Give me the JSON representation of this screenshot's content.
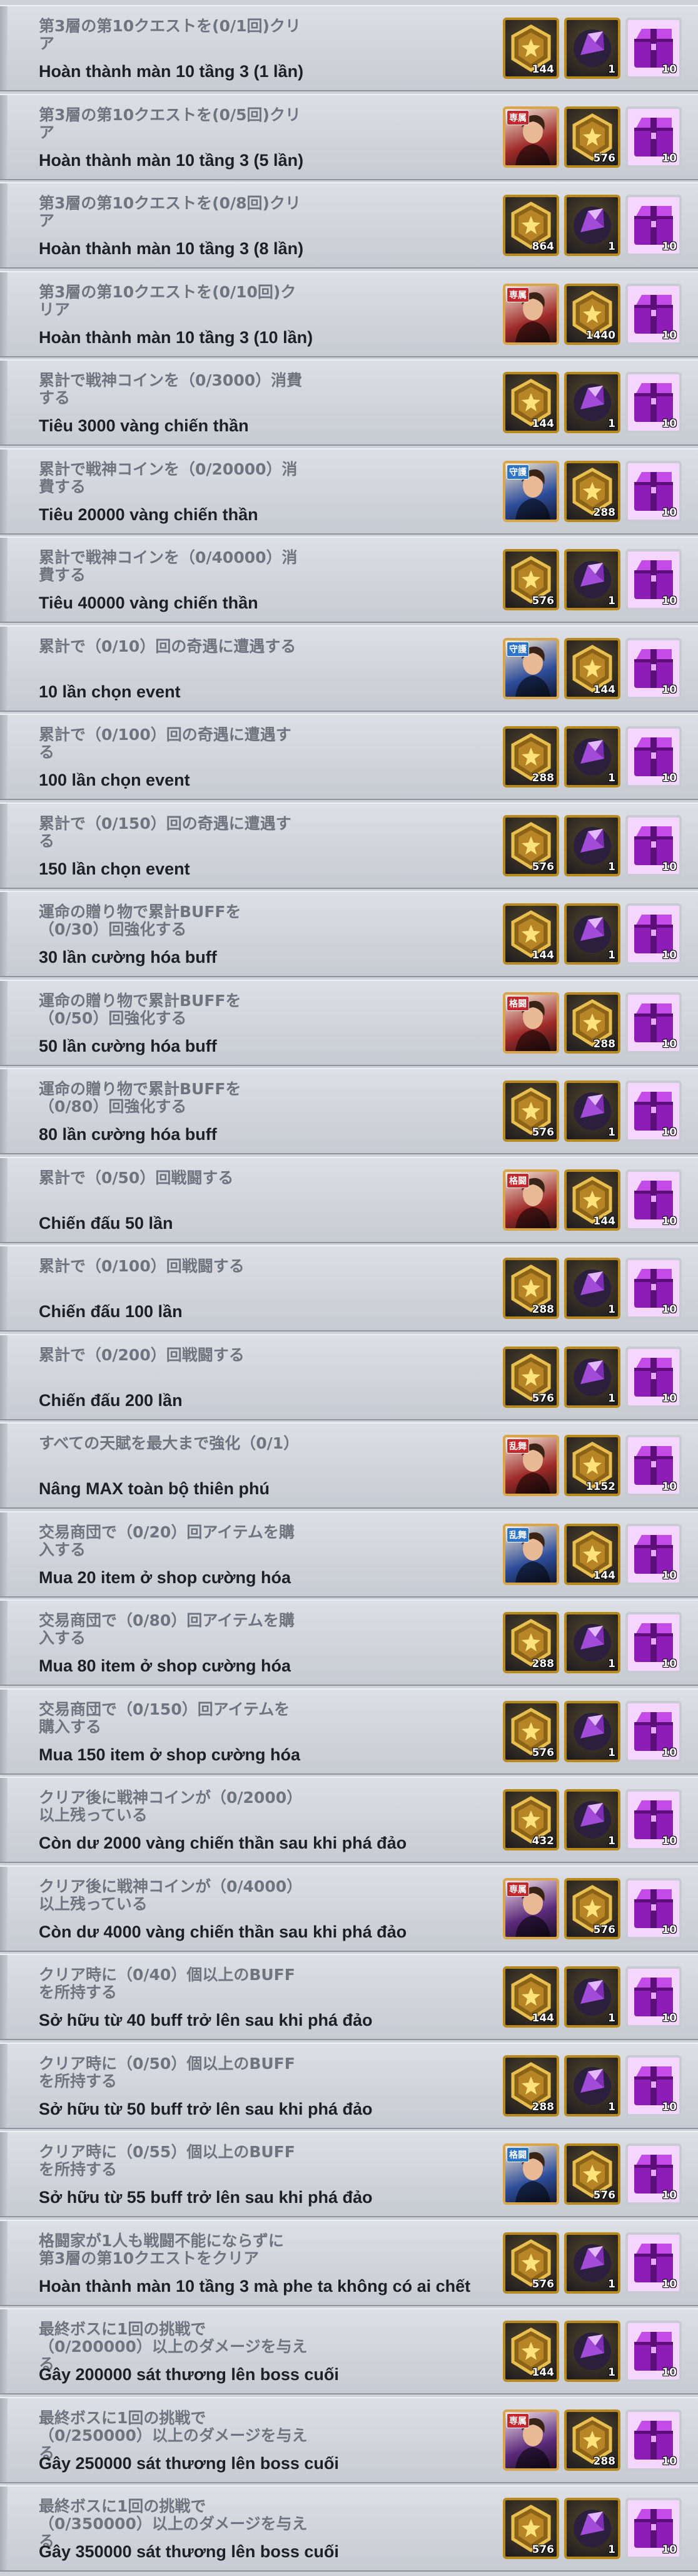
{
  "quests": [
    {
      "jp": "第3層の第10クエストを(0/1回)クリ\nア",
      "vi": "Hoàn thành màn 10 tầng 3 (1 lần)",
      "rewards": [
        {
          "type": "medal",
          "icon": "star-medal-icon",
          "qty": "144"
        },
        {
          "type": "gem",
          "icon": "purple-gem-icon",
          "qty": "1"
        },
        {
          "type": "chest",
          "icon": "purple-chest-icon",
          "qty": "10"
        }
      ]
    },
    {
      "jp": "第3層の第10クエストを(0/5回)クリ\nア",
      "vi": "Hoàn thành màn 10 tầng 3 (5 lần)",
      "rewards": [
        {
          "type": "hero",
          "icon": "fighter-portrait-icon",
          "tag": "専属",
          "tone": "red",
          "qty": ""
        },
        {
          "type": "medal",
          "icon": "star-medal-icon",
          "qty": "576"
        },
        {
          "type": "chest",
          "icon": "purple-chest-icon",
          "qty": "10"
        }
      ]
    },
    {
      "jp": "第3層の第10クエストを(0/8回)クリ\nア",
      "vi": "Hoàn thành màn 10 tầng 3 (8 lần)",
      "rewards": [
        {
          "type": "medal",
          "icon": "star-medal-icon",
          "qty": "864"
        },
        {
          "type": "gem",
          "icon": "purple-gem-icon",
          "qty": "1"
        },
        {
          "type": "chest",
          "icon": "purple-chest-icon",
          "qty": "10"
        }
      ]
    },
    {
      "jp": "第3層の第10クエストを(0/10回)ク\nリア",
      "vi": "Hoàn thành màn 10 tầng 3 (10 lần)",
      "rewards": [
        {
          "type": "hero",
          "icon": "masked-fighter-portrait-icon",
          "tag": "専属",
          "tone": "red",
          "qty": ""
        },
        {
          "type": "medal",
          "icon": "star-medal-icon",
          "qty": "1440"
        },
        {
          "type": "chest",
          "icon": "purple-chest-icon",
          "qty": "10"
        }
      ]
    },
    {
      "jp": "累計で戦神コインを（0/3000）消費\nする",
      "vi": "Tiêu 3000 vàng chiến thần",
      "rewards": [
        {
          "type": "medal",
          "icon": "star-medal-icon",
          "qty": "144"
        },
        {
          "type": "gem",
          "icon": "purple-gem-icon",
          "qty": "1"
        },
        {
          "type": "chest",
          "icon": "purple-chest-icon",
          "qty": "10"
        }
      ]
    },
    {
      "jp": "累計で戦神コインを（0/20000）消\n費する",
      "vi": "Tiêu 20000 vàng chiến thần",
      "rewards": [
        {
          "type": "hero",
          "icon": "blonde-fighter-portrait-icon",
          "tag": "守護",
          "tone": "blue",
          "qty": ""
        },
        {
          "type": "medal",
          "icon": "star-medal-icon",
          "qty": "288"
        },
        {
          "type": "chest",
          "icon": "purple-chest-icon",
          "qty": "10"
        }
      ]
    },
    {
      "jp": "累計で戦神コインを（0/40000）消\n費する",
      "vi": "Tiêu 40000 vàng chiến thần",
      "rewards": [
        {
          "type": "medal",
          "icon": "star-medal-icon",
          "qty": "576"
        },
        {
          "type": "gem",
          "icon": "purple-gem-icon",
          "qty": "1"
        },
        {
          "type": "chest",
          "icon": "purple-chest-icon",
          "qty": "10"
        }
      ]
    },
    {
      "jp": "累計で（0/10）回の奇遇に遭遇する",
      "vi": "10 lần chọn event",
      "rewards": [
        {
          "type": "hero",
          "icon": "fighter-portrait-icon",
          "tag": "守護",
          "tone": "blue",
          "qty": ""
        },
        {
          "type": "medal",
          "icon": "star-medal-icon",
          "qty": "144"
        },
        {
          "type": "chest",
          "icon": "purple-chest-icon",
          "qty": "10"
        }
      ]
    },
    {
      "jp": "累計で（0/100）回の奇遇に遭遇す\nる",
      "vi": "100 lần chọn event",
      "rewards": [
        {
          "type": "medal",
          "icon": "star-medal-icon",
          "qty": "288"
        },
        {
          "type": "gem",
          "icon": "purple-gem-icon",
          "qty": "1"
        },
        {
          "type": "chest",
          "icon": "purple-chest-icon",
          "qty": "10"
        }
      ]
    },
    {
      "jp": "累計で（0/150）回の奇遇に遭遇す\nる",
      "vi": "150 lần chọn event",
      "rewards": [
        {
          "type": "medal",
          "icon": "star-medal-icon",
          "qty": "576"
        },
        {
          "type": "gem",
          "icon": "purple-gem-icon",
          "qty": "1"
        },
        {
          "type": "chest",
          "icon": "purple-chest-icon",
          "qty": "10"
        }
      ]
    },
    {
      "jp": "運命の贈り物で累計BUFFを\n（0/30）回強化する",
      "vi": "30 lần cường hóa buff",
      "rewards": [
        {
          "type": "medal",
          "icon": "star-medal-icon",
          "qty": "144"
        },
        {
          "type": "gem",
          "icon": "purple-gem-icon",
          "qty": "1"
        },
        {
          "type": "chest",
          "icon": "purple-chest-icon",
          "qty": "10"
        }
      ]
    },
    {
      "jp": "運命の贈り物で累計BUFFを\n（0/50）回強化する",
      "vi": "50 lần cường hóa buff",
      "rewards": [
        {
          "type": "hero",
          "icon": "bald-fighter-portrait-icon",
          "tag": "格闘",
          "tone": "red",
          "qty": ""
        },
        {
          "type": "medal",
          "icon": "star-medal-icon",
          "qty": "288"
        },
        {
          "type": "chest",
          "icon": "purple-chest-icon",
          "qty": "10"
        }
      ]
    },
    {
      "jp": "運命の贈り物で累計BUFFを\n（0/80）回強化する",
      "vi": "80 lần cường hóa buff",
      "rewards": [
        {
          "type": "medal",
          "icon": "star-medal-icon",
          "qty": "576"
        },
        {
          "type": "gem",
          "icon": "purple-gem-icon",
          "qty": "1"
        },
        {
          "type": "chest",
          "icon": "purple-chest-icon",
          "qty": "10"
        }
      ]
    },
    {
      "jp": "累計で（0/50）回戦闘する",
      "vi": "Chiến đấu 50 lần",
      "rewards": [
        {
          "type": "hero",
          "icon": "blonde-fighter-portrait-icon",
          "tag": "格闘",
          "tone": "red",
          "qty": ""
        },
        {
          "type": "medal",
          "icon": "star-medal-icon",
          "qty": "144"
        },
        {
          "type": "chest",
          "icon": "purple-chest-icon",
          "qty": "10"
        }
      ]
    },
    {
      "jp": "累計で（0/100）回戦闘する",
      "vi": "Chiến đấu 100 lần",
      "rewards": [
        {
          "type": "medal",
          "icon": "star-medal-icon",
          "qty": "288"
        },
        {
          "type": "gem",
          "icon": "purple-gem-icon",
          "qty": "1"
        },
        {
          "type": "chest",
          "icon": "purple-chest-icon",
          "qty": "10"
        }
      ]
    },
    {
      "jp": "累計で（0/200）回戦闘する",
      "vi": "Chiến đấu 200 lần",
      "rewards": [
        {
          "type": "medal",
          "icon": "star-medal-icon",
          "qty": "576"
        },
        {
          "type": "gem",
          "icon": "purple-gem-icon",
          "qty": "1"
        },
        {
          "type": "chest",
          "icon": "purple-chest-icon",
          "qty": "10"
        }
      ]
    },
    {
      "jp": "すべての天賦を最大まで強化（0/1）",
      "vi": "Nâng MAX toàn bộ thiên phú",
      "rewards": [
        {
          "type": "hero",
          "icon": "fighter-portrait-icon",
          "tag": "乱舞",
          "tone": "red",
          "qty": ""
        },
        {
          "type": "medal",
          "icon": "star-medal-icon",
          "qty": "1152"
        },
        {
          "type": "chest",
          "icon": "purple-chest-icon",
          "qty": "10"
        }
      ]
    },
    {
      "jp": "交易商団で（0/20）回アイテムを購\n入する",
      "vi": "Mua 20 item ở shop cường hóa",
      "rewards": [
        {
          "type": "hero",
          "icon": "female-fighter-portrait-icon",
          "tag": "乱舞",
          "tone": "blue",
          "qty": ""
        },
        {
          "type": "medal",
          "icon": "star-medal-icon",
          "qty": "144"
        },
        {
          "type": "chest",
          "icon": "purple-chest-icon",
          "qty": "10"
        }
      ]
    },
    {
      "jp": "交易商団で（0/80）回アイテムを購\n入する",
      "vi": "Mua 80 item ở shop cường hóa",
      "rewards": [
        {
          "type": "medal",
          "icon": "star-medal-icon",
          "qty": "288"
        },
        {
          "type": "gem",
          "icon": "purple-gem-icon",
          "qty": "1"
        },
        {
          "type": "chest",
          "icon": "purple-chest-icon",
          "qty": "10"
        }
      ]
    },
    {
      "jp": "交易商団で（0/150）回アイテムを\n購入する",
      "vi": "Mua 150 item ở shop cường hóa",
      "rewards": [
        {
          "type": "medal",
          "icon": "star-medal-icon",
          "qty": "576"
        },
        {
          "type": "gem",
          "icon": "purple-gem-icon",
          "qty": "1"
        },
        {
          "type": "chest",
          "icon": "purple-chest-icon",
          "qty": "10"
        }
      ]
    },
    {
      "jp": "クリア後に戦神コインが（0/2000）\n以上残っている",
      "vi": "Còn dư 2000 vàng chiến thần sau khi phá đảo",
      "rewards": [
        {
          "type": "medal",
          "icon": "star-medal-icon",
          "qty": "432"
        },
        {
          "type": "gem",
          "icon": "purple-gem-icon",
          "qty": "1"
        },
        {
          "type": "chest",
          "icon": "purple-chest-icon",
          "qty": "10"
        }
      ]
    },
    {
      "jp": "クリア後に戦神コインが（0/4000）\n以上残っている",
      "vi": "Còn dư 4000 vàng chiến thần sau khi phá đảo",
      "rewards": [
        {
          "type": "hero",
          "icon": "female-fighter-portrait-icon",
          "tag": "専属",
          "tone": "purple",
          "qty": ""
        },
        {
          "type": "medal",
          "icon": "star-medal-icon",
          "qty": "576"
        },
        {
          "type": "chest",
          "icon": "purple-chest-icon",
          "qty": "10"
        }
      ]
    },
    {
      "jp": "クリア時に（0/40）個以上のBUFF\nを所持する",
      "vi": "Sở hữu từ 40 buff trở lên sau khi phá đảo",
      "rewards": [
        {
          "type": "medal",
          "icon": "star-medal-icon",
          "qty": "144"
        },
        {
          "type": "gem",
          "icon": "purple-gem-icon",
          "qty": "1"
        },
        {
          "type": "chest",
          "icon": "purple-chest-icon",
          "qty": "10"
        }
      ]
    },
    {
      "jp": "クリア時に（0/50）個以上のBUFF\nを所持する",
      "vi": "Sở hữu từ 50 buff trở lên sau khi phá đảo",
      "rewards": [
        {
          "type": "medal",
          "icon": "star-medal-icon",
          "qty": "288"
        },
        {
          "type": "gem",
          "icon": "purple-gem-icon",
          "qty": "1"
        },
        {
          "type": "chest",
          "icon": "purple-chest-icon",
          "qty": "10"
        }
      ]
    },
    {
      "jp": "クリア時に（0/55）個以上のBUFF\nを所持する",
      "vi": "Sở hữu từ 55 buff trở lên sau khi phá đảo",
      "rewards": [
        {
          "type": "hero",
          "icon": "bald-fighter-portrait-icon",
          "tag": "格闘",
          "tone": "blue",
          "qty": ""
        },
        {
          "type": "medal",
          "icon": "star-medal-icon",
          "qty": "576"
        },
        {
          "type": "chest",
          "icon": "purple-chest-icon",
          "qty": "10"
        }
      ]
    },
    {
      "jp": "格闘家が1人も戦闘不能にならずに\n第3層の第10クエストをクリア",
      "vi": "Hoàn thành màn 10 tầng 3 mà phe ta không có ai chết",
      "rewards": [
        {
          "type": "medal",
          "icon": "star-medal-icon",
          "qty": "576"
        },
        {
          "type": "gem",
          "icon": "purple-gem-icon",
          "qty": "1"
        },
        {
          "type": "chest",
          "icon": "purple-chest-icon",
          "qty": "10"
        }
      ]
    },
    {
      "jp": "最終ボスに1回の挑戦で\n（0/200000）以上のダメージを与え\nる",
      "vi": "Gây 200000 sát thương lên boss cuối",
      "rewards": [
        {
          "type": "medal",
          "icon": "star-medal-icon",
          "qty": "144"
        },
        {
          "type": "gem",
          "icon": "purple-gem-icon",
          "qty": "1"
        },
        {
          "type": "chest",
          "icon": "purple-chest-icon",
          "qty": "10"
        }
      ]
    },
    {
      "jp": "最終ボスに1回の挑戦で\n（0/250000）以上のダメージを与え\nる",
      "vi": "Gây 250000 sát thương lên boss cuối",
      "rewards": [
        {
          "type": "hero",
          "icon": "female-fighter-portrait-icon",
          "tag": "専属",
          "tone": "purple",
          "qty": ""
        },
        {
          "type": "medal",
          "icon": "star-medal-icon",
          "qty": "288"
        },
        {
          "type": "chest",
          "icon": "purple-chest-icon",
          "qty": "10"
        }
      ]
    },
    {
      "jp": "最終ボスに1回の挑戦で\n（0/350000）以上のダメージを与え\nる",
      "vi": "Gây 350000 sát thương lên boss cuối",
      "rewards": [
        {
          "type": "medal",
          "icon": "star-medal-icon",
          "qty": "576"
        },
        {
          "type": "gem",
          "icon": "purple-gem-icon",
          "qty": "1"
        },
        {
          "type": "chest",
          "icon": "purple-chest-icon",
          "qty": "10"
        }
      ]
    }
  ]
}
